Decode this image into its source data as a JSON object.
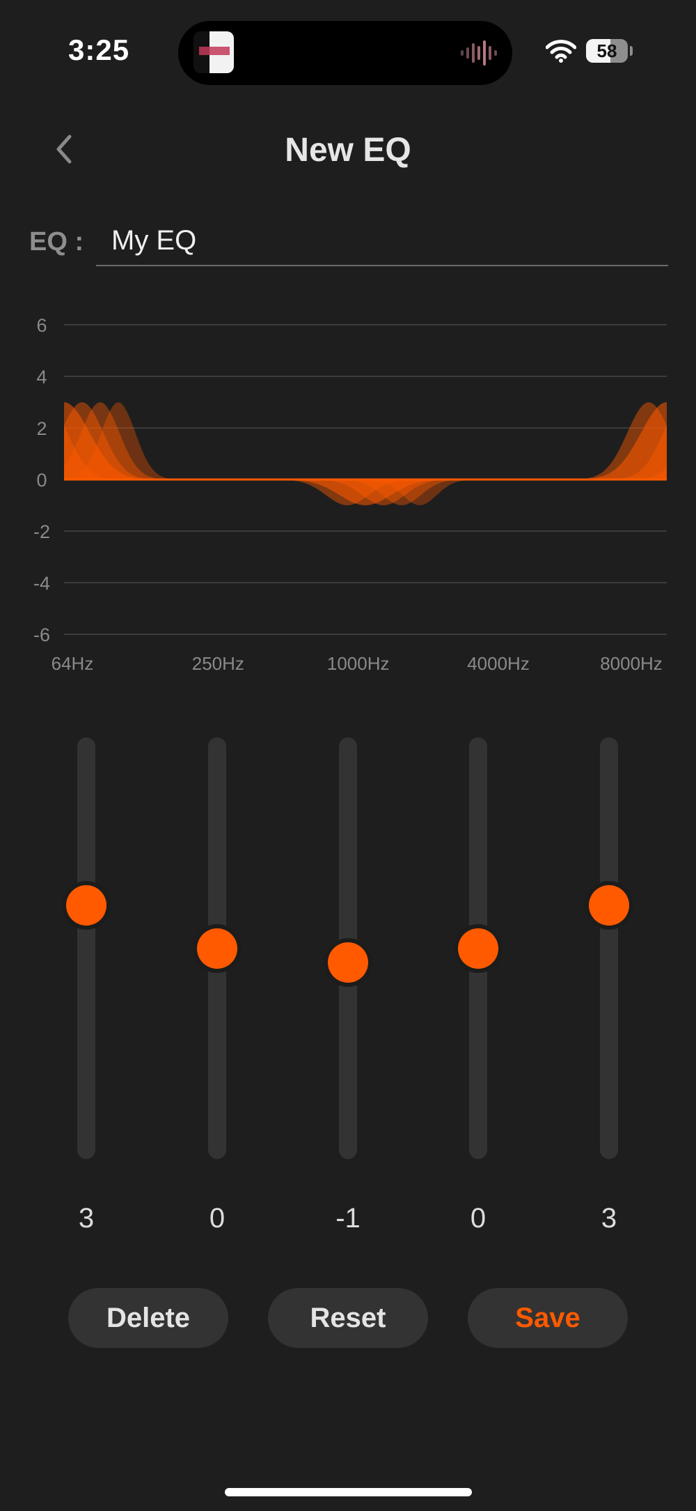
{
  "status_bar": {
    "time": "3:25",
    "battery": "58",
    "icons": [
      "wifi-icon",
      "battery-icon",
      "waveform-icon",
      "album-art-icon"
    ]
  },
  "header": {
    "title": "New EQ",
    "back_icon": "chevron-left-icon"
  },
  "eq_name": {
    "label": "EQ :",
    "value": "My EQ"
  },
  "chart_data": {
    "type": "area",
    "y_ticks": [
      "6",
      "4",
      "2",
      "0",
      "-2",
      "-4",
      "-6"
    ],
    "ylim": [
      -6,
      6
    ],
    "x_labels": [
      "64Hz",
      "250Hz",
      "1000Hz",
      "4000Hz",
      "8000Hz"
    ],
    "series": [
      {
        "values": [
          3,
          0,
          -1,
          0,
          3
        ]
      }
    ],
    "grid": true,
    "colors": {
      "fill": "#ff5a00",
      "grid": "#3c3c3c",
      "labels": "#8a8a8a"
    }
  },
  "bands": [
    {
      "frequency": "64Hz",
      "value": "3",
      "level": 3
    },
    {
      "frequency": "250Hz",
      "value": "0",
      "level": 0
    },
    {
      "frequency": "1000Hz",
      "value": "-1",
      "level": -1
    },
    {
      "frequency": "4000Hz",
      "value": "0",
      "level": 0
    },
    {
      "frequency": "8000Hz",
      "value": "3",
      "level": 3
    }
  ],
  "buttons": {
    "delete": "Delete",
    "reset": "Reset",
    "save": "Save"
  },
  "colors": {
    "accent": "#ff5a00",
    "background": "#1e1e1e",
    "button_bg": "#333333"
  }
}
